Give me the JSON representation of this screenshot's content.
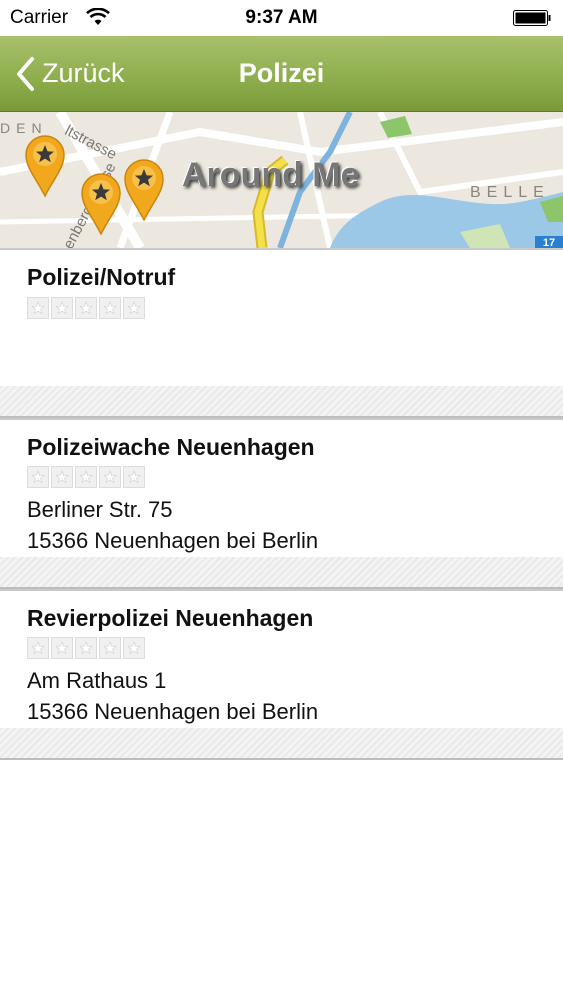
{
  "status_bar": {
    "carrier": "Carrier",
    "time": "9:37 AM"
  },
  "nav": {
    "back_label": "Zurück",
    "title": "Polizei"
  },
  "map": {
    "title": "Around Me",
    "route_badge": "17",
    "label_belle": "BELLE",
    "label_street1": "ltstrasse",
    "label_street2": "enbergstrasse",
    "label_den": "DEN"
  },
  "entries": [
    {
      "name": "Polizei/Notruf",
      "rating": 0,
      "address_line1": "",
      "address_line2": ""
    },
    {
      "name": "Polizeiwache Neuenhagen",
      "rating": 0,
      "address_line1": "Berliner Str. 75",
      "address_line2": "15366 Neuenhagen bei Berlin"
    },
    {
      "name": "Revierpolizei Neuenhagen",
      "rating": 0,
      "address_line1": "Am Rathaus 1",
      "address_line2": "15366 Neuenhagen bei Berlin"
    }
  ],
  "colors": {
    "navbar": "#8fae4e",
    "pin": "#f2a81d",
    "route": "#e8d23a"
  }
}
